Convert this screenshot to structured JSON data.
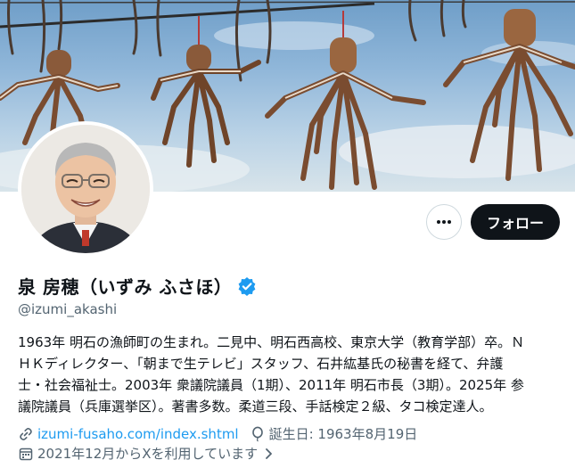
{
  "profile": {
    "name": "泉 房穂（いずみ ふさほ）",
    "handle": "@izumi_akashi",
    "bio_lines": [
      "1963年 明石の漁師町の生まれ。二見中、明石西高校、東京大学（教育学部）卒。Ｎ",
      "ＨＫディレクター、「朝まで生テレビ」スタッフ、石井紘基氏の秘書を経て、弁護",
      "士・社会福祉士。2003年 衆議院議員（1期）、2011年 明石市長（3期）。2025年 参",
      "議院議員（兵庫選挙区）。著書多数。柔道三段、手話検定２級、タコ検定達人。"
    ],
    "website": "izumi-fusaho.com/index.shtml",
    "birthday": "誕生日: 1963年8月19日",
    "joined": "2021年12月からXを利用しています"
  },
  "actions": {
    "follow_label": "フォロー"
  },
  "icons": {
    "more": "more-horizontal-icon",
    "verified": "verified-badge-icon",
    "link": "link-icon",
    "birthday": "balloon-icon",
    "joined": "calendar-icon",
    "chevron": "chevron-right-icon"
  },
  "colors": {
    "accent": "#1d9bf0",
    "text": "#0f1419",
    "muted": "#536471",
    "button_dark": "#0f1419"
  }
}
